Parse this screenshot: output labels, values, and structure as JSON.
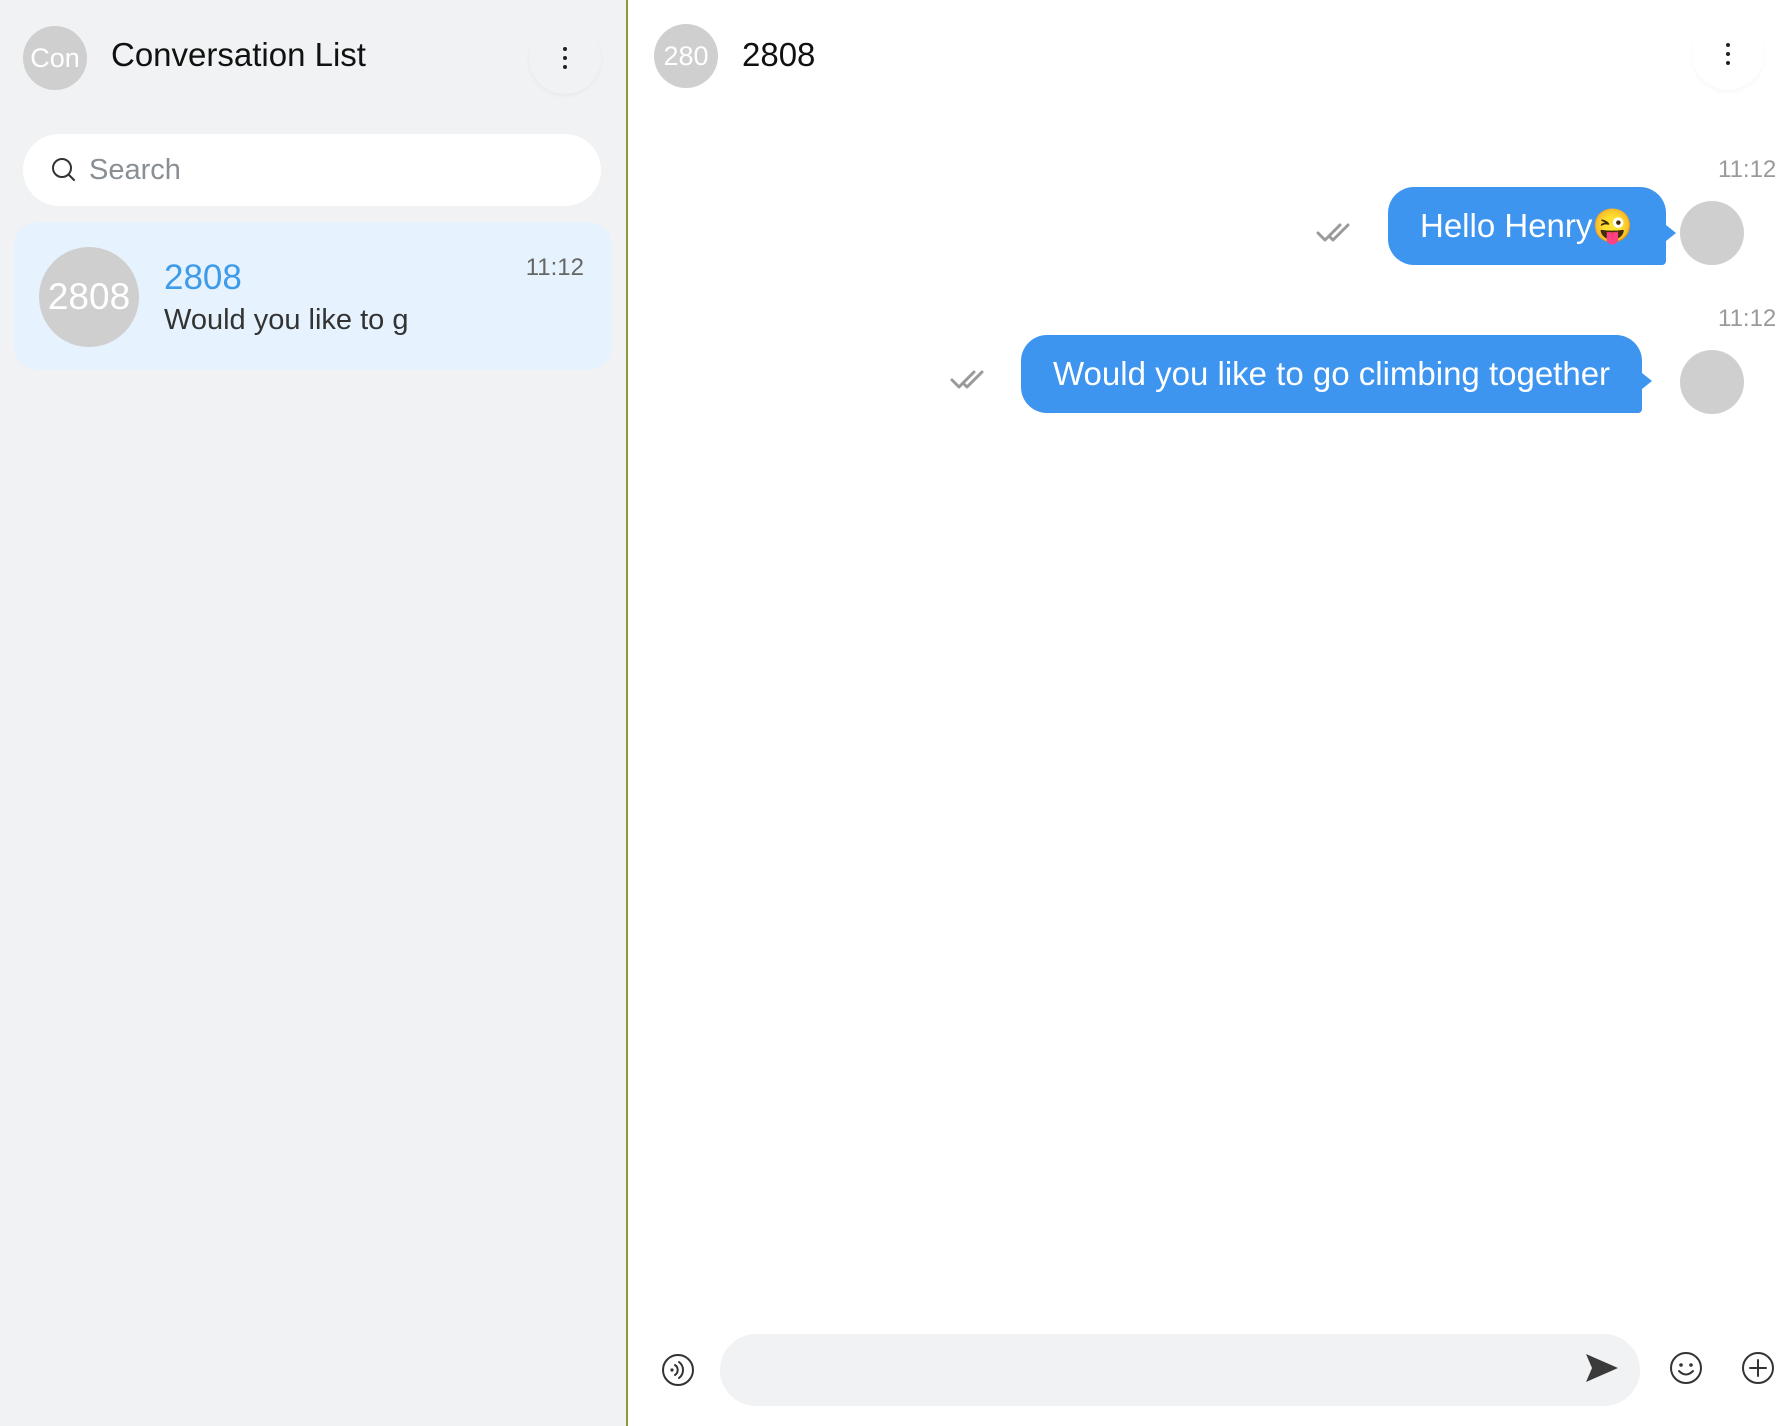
{
  "left_panel": {
    "avatar_text": "Con",
    "title": "Conversation List",
    "search": {
      "placeholder": "Search",
      "value": ""
    },
    "conversations": [
      {
        "avatar_text": "2808",
        "name": "2808",
        "preview": "Would you like to g",
        "time": "11:12",
        "selected": true
      }
    ]
  },
  "chat": {
    "avatar_text": "280",
    "title": "2808",
    "messages": [
      {
        "time": "11:12",
        "text": "Hello Henry😜",
        "status": "read-double-check"
      },
      {
        "time": "11:12",
        "text": "Would you like to go climbing together",
        "status": "read-double-check"
      }
    ],
    "composer": {
      "value": "",
      "placeholder": ""
    }
  },
  "colors": {
    "accent": "#3d95ef",
    "selected_bg": "#e6f3fe",
    "panel_bg": "#f0f2f3",
    "divider": "#8b9b3a",
    "name_link": "#3d9be9"
  },
  "icons": {
    "left_menu": "more-vertical-icon",
    "search": "search-icon",
    "chat_menu": "more-vertical-icon",
    "voice": "voice-icon",
    "send": "send-icon",
    "emoji": "emoji-icon",
    "add": "plus-circle-icon",
    "read": "double-check-icon"
  }
}
